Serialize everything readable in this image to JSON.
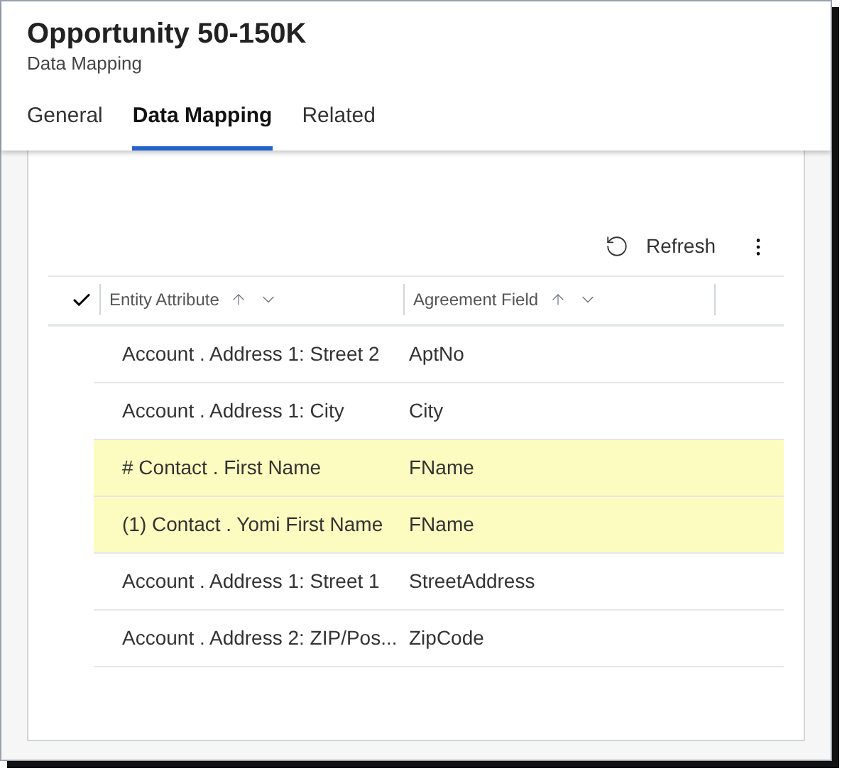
{
  "header": {
    "title": "Opportunity 50-150K",
    "subtitle": "Data Mapping"
  },
  "tabs": [
    {
      "label": "General",
      "selected": false
    },
    {
      "label": "Data Mapping",
      "selected": true
    },
    {
      "label": "Related",
      "selected": false
    }
  ],
  "toolbar": {
    "refresh": "Refresh"
  },
  "table": {
    "select_all": {
      "checked": true
    },
    "columns": [
      {
        "label": "Entity Attribute"
      },
      {
        "label": "Agreement Field"
      }
    ],
    "rows": [
      {
        "cells": [
          "Account . Address 1: Street 2",
          "AptNo"
        ],
        "highlighted": false
      },
      {
        "cells": [
          "Account . Address 1: City",
          "City"
        ],
        "highlighted": false
      },
      {
        "cells": [
          "# Contact . First Name",
          "FName"
        ],
        "highlighted": true
      },
      {
        "cells": [
          "(1) Contact . Yomi First Name",
          "FName"
        ],
        "highlighted": true
      },
      {
        "cells": [
          "Account . Address 1: Street 1",
          "StreetAddress"
        ],
        "highlighted": false
      },
      {
        "cells": [
          "Account . Address 2: ZIP/Pos...",
          "ZipCode"
        ],
        "highlighted": false
      }
    ]
  }
}
